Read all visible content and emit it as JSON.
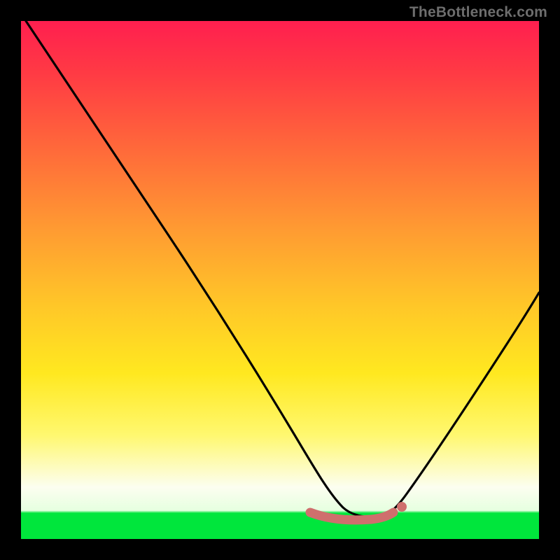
{
  "watermark": "TheBottleneck.com",
  "chart_data": {
    "type": "line",
    "title": "",
    "xlabel": "",
    "ylabel": "",
    "xlim": [
      0,
      100
    ],
    "ylim": [
      0,
      100
    ],
    "grid": false,
    "series": [
      {
        "name": "curve",
        "x": [
          1,
          6,
          12,
          20,
          28,
          36,
          44,
          50,
          55,
          58,
          60,
          63,
          66,
          70,
          72,
          76,
          82,
          88,
          94,
          100
        ],
        "y": [
          100,
          91,
          82,
          70,
          58,
          46,
          34,
          25,
          17,
          12,
          9,
          6,
          5,
          5,
          6,
          10,
          19,
          30,
          42,
          55
        ]
      }
    ],
    "markers": [
      {
        "name": "valley-fill",
        "x_start": 55,
        "x_end": 70,
        "y": 5,
        "color": "#d46a6a"
      },
      {
        "name": "valley-dot",
        "x": 71,
        "y": 6,
        "color": "#d46a6a"
      }
    ],
    "background_gradient": {
      "stops": [
        {
          "pct": 0,
          "color": "#ff1f4f"
        },
        {
          "pct": 25,
          "color": "#ff6a3a"
        },
        {
          "pct": 55,
          "color": "#ffc728"
        },
        {
          "pct": 80,
          "color": "#fff870"
        },
        {
          "pct": 94,
          "color": "#e6ffe0"
        },
        {
          "pct": 95,
          "color": "#00e63c"
        },
        {
          "pct": 100,
          "color": "#00e63c"
        }
      ]
    }
  }
}
